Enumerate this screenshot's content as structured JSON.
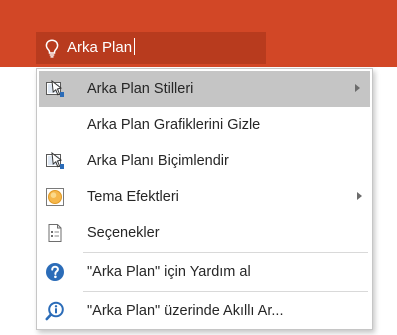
{
  "search": {
    "query": "Arka Plan"
  },
  "menu": {
    "items": [
      {
        "label": "Arka Plan Stilleri",
        "icon": "background-styles-icon",
        "submenu": true,
        "highlighted": true
      },
      {
        "label": "Arka Plan Grafiklerini Gizle",
        "icon": "",
        "submenu": false
      },
      {
        "label": "Arka Planı Biçimlendir",
        "icon": "format-background-icon",
        "submenu": false
      },
      {
        "label": "Tema Efektleri",
        "icon": "theme-effects-icon",
        "submenu": true
      },
      {
        "label": "Seçenekler",
        "icon": "options-icon",
        "submenu": false
      },
      {
        "label": "\"Arka Plan\" için Yardım al",
        "icon": "help-icon",
        "submenu": false
      },
      {
        "label": "\"Arka Plan\" üzerinde Akıllı Ar...",
        "icon": "smart-lookup-icon",
        "submenu": false
      }
    ]
  },
  "colors": {
    "ribbon": "#d24726",
    "search_box": "#b83b1e",
    "highlight": "#c5c5c5",
    "help_blue": "#2b6cb8"
  }
}
